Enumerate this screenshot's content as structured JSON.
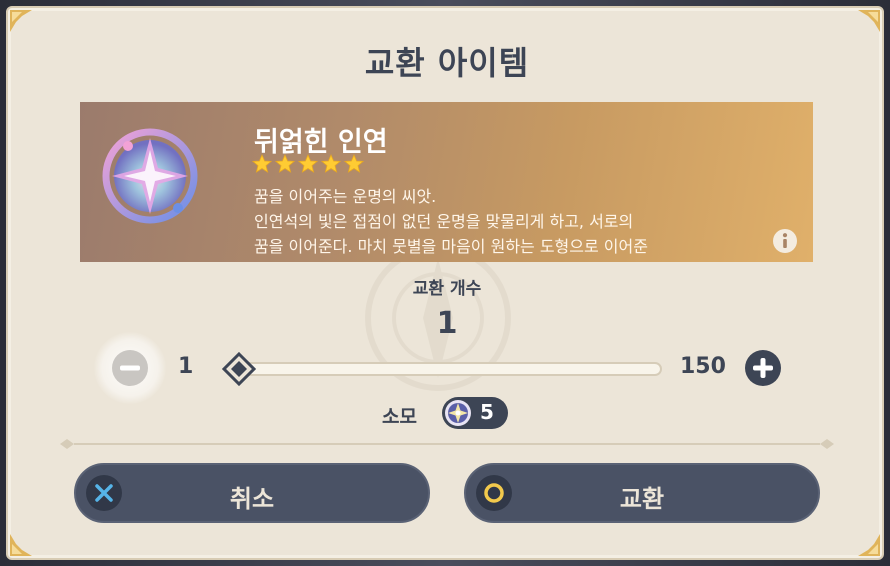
{
  "dialog": {
    "title": "교환 아이템"
  },
  "item": {
    "name": "뒤얽힌 인연",
    "rarity": 5,
    "description_lines": [
      "꿈을 이어주는 운명의 씨앗.",
      "인연석의 빛은 접점이 없던 운명을 맞물리게 하고, 서로의",
      "꿈을 이어준다. 마치 뭇별을 마음이 원하는 도형으로 이어준"
    ],
    "icon": "intertwined-fate-icon"
  },
  "exchange": {
    "count_label": "교환 개수",
    "count_value": "1",
    "min_label": "1",
    "max_label": "150",
    "slider_fraction": 0.0
  },
  "cost": {
    "label": "소모",
    "value": "5",
    "icon": "starglitter-icon"
  },
  "buttons": {
    "cancel_label": "취소",
    "confirm_label": "교환"
  },
  "colors": {
    "panel": "#ece5d8",
    "text_dark": "#3d4555",
    "button": "#4a5265",
    "cancel_icon": "#56b4e8",
    "confirm_icon": "#f2c94c",
    "star": "#ffcc33"
  }
}
